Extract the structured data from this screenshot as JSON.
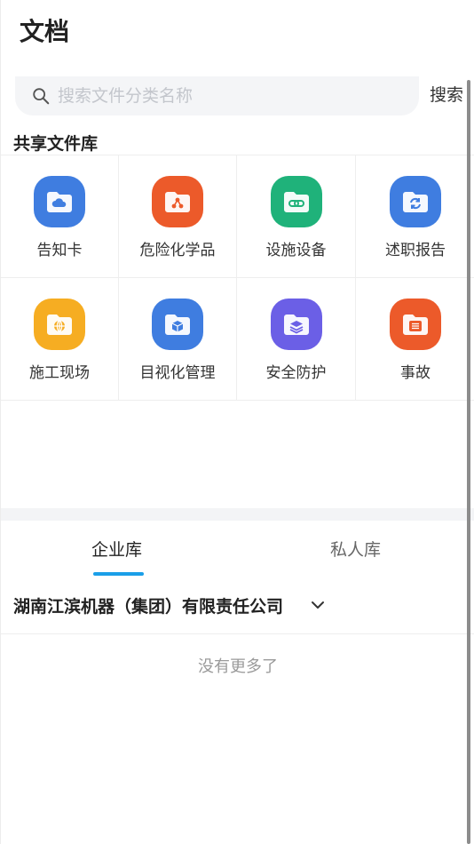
{
  "header": {
    "title": "文档"
  },
  "search": {
    "placeholder": "搜索文件分类名称",
    "button_label": "搜索"
  },
  "shared_library": {
    "title": "共享文件库",
    "items": [
      {
        "label": "告知卡",
        "icon": "cloud-folder-icon",
        "color": "#3f7de0"
      },
      {
        "label": "危险化学品",
        "icon": "hazard-folder-icon",
        "color": "#ec5a2a"
      },
      {
        "label": "设施设备",
        "icon": "link-folder-icon",
        "color": "#1fb27a"
      },
      {
        "label": "述职报告",
        "icon": "sync-folder-icon",
        "color": "#3f7de0"
      },
      {
        "label": "施工现场",
        "icon": "globe-folder-icon",
        "color": "#f6ad22"
      },
      {
        "label": "目视化管理",
        "icon": "cube-folder-icon",
        "color": "#3f7de0"
      },
      {
        "label": "安全防护",
        "icon": "layers-folder-icon",
        "color": "#6b5fe6"
      },
      {
        "label": "事故",
        "icon": "list-folder-icon",
        "color": "#ec5a2a"
      }
    ]
  },
  "tabs": [
    {
      "label": "企业库",
      "active": true
    },
    {
      "label": "私人库",
      "active": false
    }
  ],
  "company": {
    "name": "湖南江滨机器（集团）有限责任公司"
  },
  "list_footer": "没有更多了",
  "colors": {
    "accent": "#1a9fe8",
    "search_bg": "#f4f5f7"
  }
}
